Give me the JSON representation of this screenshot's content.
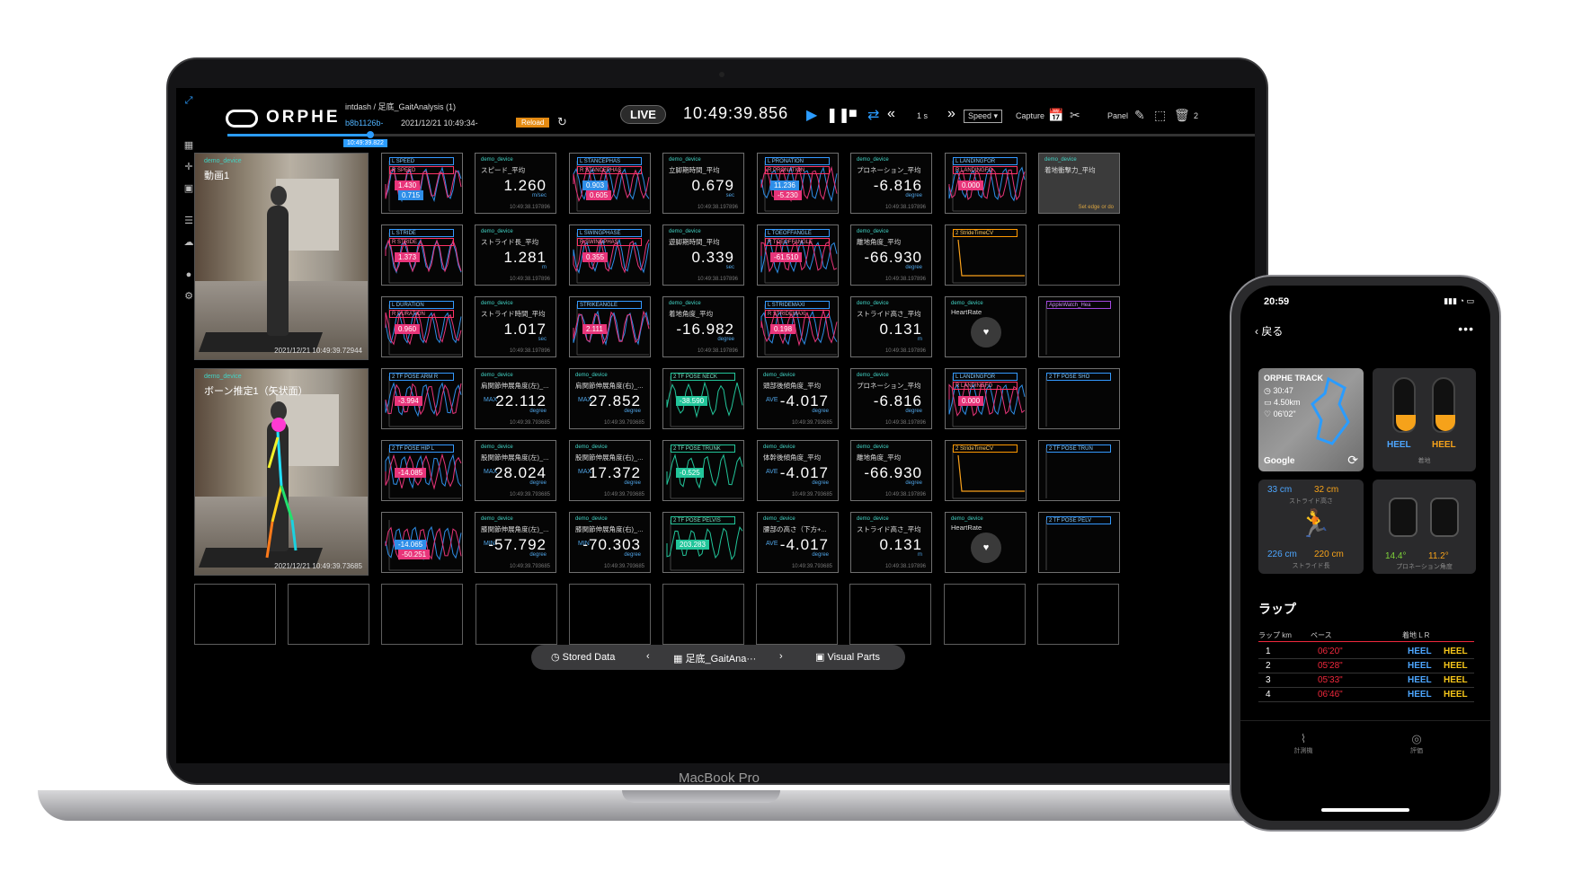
{
  "app": {
    "logo": "ORPHE",
    "breadcrumb": "intdash / 足底_GaitAnalysis (1)",
    "session_id": "b8b1126b-",
    "session_time": "2021/12/21 10:49:34-",
    "reload_label": "Reload",
    "live_label": "LIVE",
    "clock": "10:49:39.856",
    "step": "1 s",
    "speed_select": "Speed",
    "capture_label": "Capture",
    "panel_label": "Panel",
    "page_num": "2",
    "timeline_time": "10:49:39.822"
  },
  "videos": [
    {
      "device": "demo_device",
      "title": "動画1",
      "timestamp": "2021/12/21 10:49:39.72944"
    },
    {
      "device": "demo_device",
      "title": "ボーン推定1（矢状面）",
      "timestamp": "2021/12/21 10:49:39.73685"
    }
  ],
  "cells": [
    {
      "kind": "graph",
      "l": "L SPEED",
      "r": "R SPEED",
      "tags": [
        {
          "v": "1.430",
          "c": "#e8357a"
        },
        {
          "v": "0.715",
          "c": "#2e8ee8"
        }
      ]
    },
    {
      "kind": "value",
      "device": "demo_device",
      "name": "スピード_平均",
      "value": "1.260",
      "unit": "m/sec",
      "ts": "10:49:38.197896"
    },
    {
      "kind": "graph",
      "l": "L STANCEPHAS",
      "r": "R STANCEPHAS",
      "tags": [
        {
          "v": "0.903",
          "c": "#2e8ee8"
        },
        {
          "v": "0.605",
          "c": "#e8357a"
        }
      ]
    },
    {
      "kind": "value",
      "device": "demo_device",
      "name": "立脚期時間_平均",
      "value": "0.679",
      "unit": "sec",
      "ts": "10:49:38.197896"
    },
    {
      "kind": "graph",
      "l": "L PRONATION",
      "r": "R PRONATION",
      "tags": [
        {
          "v": "11.236",
          "c": "#2e8ee8"
        },
        {
          "v": "-5.230",
          "c": "#e8357a"
        }
      ]
    },
    {
      "kind": "value",
      "device": "demo_device",
      "name": "プロネーション_平均",
      "value": "-6.816",
      "unit": "degree",
      "ts": "10:49:38.197896"
    },
    {
      "kind": "graph",
      "l": "L LANDINGFOR",
      "r": "R LANDINGFO",
      "tags": [
        {
          "v": "0.000",
          "c": "#e8357a"
        }
      ]
    },
    {
      "kind": "value",
      "device": "demo_device",
      "name": "着地衝撃力_平均",
      "value": "",
      "unit": "",
      "ts": "",
      "gray": true,
      "note": "Set edge or do"
    },
    {
      "kind": "graph",
      "l": "L STRIDE",
      "r": "R STRIDE",
      "tags": [
        {
          "v": "1.373",
          "c": "#e8357a"
        }
      ]
    },
    {
      "kind": "value",
      "device": "demo_device",
      "name": "ストライド長_平均",
      "value": "1.281",
      "unit": "m",
      "ts": "10:49:38.197896"
    },
    {
      "kind": "graph",
      "l": "L SWINGPHASE",
      "r": "R SWINGPHAS",
      "tags": [
        {
          "v": "0.355",
          "c": "#e8357a"
        }
      ]
    },
    {
      "kind": "value",
      "device": "demo_device",
      "name": "遊脚期時間_平均",
      "value": "0.339",
      "unit": "sec",
      "ts": "10:49:38.197896"
    },
    {
      "kind": "graph",
      "l": "L TOEOFFANGLE",
      "r": "R TOEOFFANGLE",
      "tags": [
        {
          "v": "-61.510",
          "c": "#e8357a"
        }
      ]
    },
    {
      "kind": "value",
      "device": "demo_device",
      "name": "離地角度_平均",
      "value": "-66.930",
      "unit": "degree",
      "ts": "10:49:38.197896"
    },
    {
      "kind": "orange",
      "l": "2 StrideTimeCV"
    },
    {
      "kind": "empty"
    },
    {
      "kind": "graph",
      "l": "L DURATION",
      "r": "R DURATION",
      "tags": [
        {
          "v": "0.960",
          "c": "#e8357a"
        }
      ]
    },
    {
      "kind": "value",
      "device": "demo_device",
      "name": "ストライド時間_平均",
      "value": "1.017",
      "unit": "sec",
      "ts": "10:49:38.197896"
    },
    {
      "kind": "graph",
      "l": "STRIKEANGLE",
      "r": "",
      "tags": [
        {
          "v": "2.111",
          "c": "#e8357a"
        }
      ]
    },
    {
      "kind": "value",
      "device": "demo_device",
      "name": "着地角度_平均",
      "value": "-16.982",
      "unit": "degree",
      "ts": "10:49:38.197896"
    },
    {
      "kind": "graph",
      "l": "L STRIDEMAXI",
      "r": "R STRIDEMAXI",
      "tags": [
        {
          "v": "0.198",
          "c": "#e8357a"
        }
      ]
    },
    {
      "kind": "value",
      "device": "demo_device",
      "name": "ストライド高さ_平均",
      "value": "0.131",
      "unit": "m",
      "ts": "10:49:38.197896"
    },
    {
      "kind": "heart",
      "device": "demo_device",
      "name": "HeartRate"
    },
    {
      "kind": "partial",
      "l": "AppleWatch_Hea"
    },
    {
      "kind": "graph",
      "l": "2 TF POSE ARM R",
      "r": "",
      "tags": [
        {
          "v": "-3.994",
          "c": "#e8357a"
        }
      ]
    },
    {
      "kind": "value",
      "device": "demo_device",
      "name": "肩関節伸展角度(左)_...",
      "value": "22.112",
      "unit": "degree",
      "ts": "10:49:39.793685",
      "mm": "MAX"
    },
    {
      "kind": "value",
      "device": "demo_device",
      "name": "肩関節伸展角度(右)_...",
      "value": "27.852",
      "unit": "degree",
      "ts": "10:49:39.793685",
      "mm": "MAX"
    },
    {
      "kind": "green",
      "l": "2 TF POSE NECK",
      "tags": [
        {
          "v": "-38.590",
          "c": "#22c59a"
        }
      ]
    },
    {
      "kind": "value",
      "device": "demo_device",
      "name": "頭部後傾角度_平均",
      "value": "-4.017",
      "unit": "degree",
      "ts": "10:49:39.793685",
      "mm": "AVE"
    },
    {
      "kind": "value",
      "device": "demo_device",
      "name": "プロネーション_平均",
      "value": "-6.816",
      "unit": "degree",
      "ts": "10:49:38.197896"
    },
    {
      "kind": "graph",
      "l": "L LANDINGFOR",
      "r": "R LANDINGFO",
      "tags": [
        {
          "v": "0.000",
          "c": "#e8357a"
        }
      ]
    },
    {
      "kind": "partial",
      "l": "2 TF POSE SHO"
    },
    {
      "kind": "graph",
      "l": "2 TF POSE HIP L",
      "r": "",
      "tags": [
        {
          "v": "-14.085",
          "c": "#e8357a"
        }
      ]
    },
    {
      "kind": "value",
      "device": "demo_device",
      "name": "股関節伸展角度(左)_...",
      "value": "28.024",
      "unit": "degree",
      "ts": "10:49:39.793685",
      "mm": "MAX"
    },
    {
      "kind": "value",
      "device": "demo_device",
      "name": "股関節伸展角度(右)_...",
      "value": "17.372",
      "unit": "degree",
      "ts": "10:49:39.793685",
      "mm": "MAX"
    },
    {
      "kind": "green",
      "l": "2 TF POSE TRUNK",
      "tags": [
        {
          "v": "-0.525",
          "c": "#22c59a"
        }
      ]
    },
    {
      "kind": "value",
      "device": "demo_device",
      "name": "体幹後傾角度_平均",
      "value": "-4.017",
      "unit": "degree",
      "ts": "10:49:39.793685",
      "mm": "AVE"
    },
    {
      "kind": "value",
      "device": "demo_device",
      "name": "離地角度_平均",
      "value": "-66.930",
      "unit": "degree",
      "ts": "10:49:38.197896"
    },
    {
      "kind": "orange",
      "l": "2 StrideTimeCV"
    },
    {
      "kind": "partial",
      "l": "2 TF POSE TRUN"
    },
    {
      "kind": "graph",
      "l": "",
      "r": "",
      "tags": [
        {
          "v": "-14.065",
          "c": "#2e8ee8"
        },
        {
          "v": "-50.251",
          "c": "#e8357a"
        }
      ]
    },
    {
      "kind": "value",
      "device": "demo_device",
      "name": "膝関節伸展角度(左)_...",
      "value": "-57.792",
      "unit": "degree",
      "ts": "10:49:39.793685",
      "mm": "MIN"
    },
    {
      "kind": "value",
      "device": "demo_device",
      "name": "膝関節伸展角度(右)_...",
      "value": "-70.303",
      "unit": "degree",
      "ts": "10:49:39.793685",
      "mm": "MIN"
    },
    {
      "kind": "green",
      "l": "2 TF POSE PELVIS",
      "tags": [
        {
          "v": "203.283",
          "c": "#22c59a"
        }
      ]
    },
    {
      "kind": "value",
      "device": "demo_device",
      "name": "腰部の高さ（下方+...",
      "value": "-4.017",
      "unit": "degree",
      "ts": "10:49:39.793685",
      "mm": "AVE"
    },
    {
      "kind": "value",
      "device": "demo_device",
      "name": "ストライド高さ_平均",
      "value": "0.131",
      "unit": "m",
      "ts": "10:49:38.197896"
    },
    {
      "kind": "heart",
      "device": "demo_device",
      "name": "HeartRate"
    },
    {
      "kind": "partial",
      "l": "2 TF POSE PELV"
    }
  ],
  "bottom_bar": {
    "stored": "Stored Data",
    "file": "足底_GaitAna···",
    "visual": "Visual Parts"
  },
  "mac_label": "MacBook Pro",
  "phone": {
    "time": "20:59",
    "back": "戻る",
    "track_title": "ORPHE TRACK",
    "track_time": "30:47",
    "track_dist": "4.50km",
    "track_pace": "06'02\"",
    "map_brand": "Google",
    "heel_l": "HEEL",
    "heel_r": "HEEL",
    "landing_caption": "着地",
    "stride_h_l": "33 cm",
    "stride_h_r": "32 cm",
    "stride_h_caption": "ストライド高さ",
    "stride_l_l": "226 cm",
    "stride_l_r": "220 cm",
    "stride_l_caption": "ストライド長",
    "pron_l": "14.4°",
    "pron_r": "11.2°",
    "pron_caption": "プロネーション角度",
    "lap_title": "ラップ",
    "lap_col_km": "ラップ km",
    "lap_col_pace": "ペース",
    "lap_col_landing": "着地 L R",
    "laps": [
      {
        "n": "1",
        "pace": "06'20\"",
        "l": "HEEL",
        "r": "HEEL"
      },
      {
        "n": "2",
        "pace": "05'28\"",
        "l": "HEEL",
        "r": "HEEL"
      },
      {
        "n": "3",
        "pace": "05'33\"",
        "l": "HEEL",
        "r": "HEEL"
      },
      {
        "n": "4",
        "pace": "06'46\"",
        "l": "HEEL",
        "r": "HEEL"
      }
    ],
    "tab_measure": "計測機",
    "tab_eval": "評価"
  },
  "colors": {
    "accent": "#2b9cff",
    "reload": "#e38a12",
    "left": "#2e8ee8",
    "right": "#e8357a",
    "pose": "#22c59a",
    "heel_l": "#4da6ff",
    "heel_r": "#f6c61a",
    "pace": "#f0283c"
  }
}
